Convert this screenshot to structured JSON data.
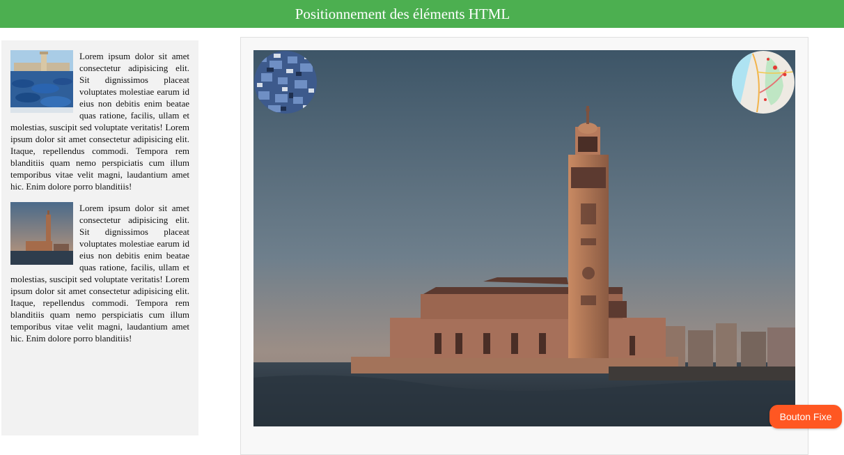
{
  "header": {
    "title": "Positionnement des éléments HTML"
  },
  "colors": {
    "header_bg": "#4caf50",
    "button_bg": "#ff5722",
    "sidebar_bg": "#f2f2f2"
  },
  "sidebar": {
    "articles": [
      {
        "image": "essaouira-port-photo",
        "text": "Lorem ipsum dolor sit amet consectetur adipisicing elit. Sit dignissimos placeat voluptates molestiae earum id eius non debitis enim beatae quas ratione, facilis, ullam et molestias, suscipit sed voluptate veritatis! Lorem ipsum dolor sit amet consectetur adipisicing elit. Itaque, repellendus commodi. Tempora rem blanditiis quam nemo perspiciatis cum illum temporibus vitae velit magni, laudantium amet hic. Enim dolore porro blanditiis!"
      },
      {
        "image": "hassan-ii-mosque-photo",
        "text": "Lorem ipsum dolor sit amet consectetur adipisicing elit. Sit dignissimos placeat voluptates molestiae earum id eius non debitis enim beatae quas ratione, facilis, ullam et molestias, suscipit sed voluptate veritatis! Lorem ipsum dolor sit amet consectetur adipisicing elit. Itaque, repellendus commodi. Tempora rem blanditiis quam nemo perspiciatis cum illum temporibus vitae velit magni, laudantium amet hic. Enim dolore porro blanditiis!"
      }
    ]
  },
  "main": {
    "hero_image": "hassan-ii-mosque-sunset-photo",
    "corner_left_image": "chefchaouen-blue-city-photo",
    "corner_right_image": "map-photo"
  },
  "fixed_button": {
    "label": "Bouton Fixe"
  }
}
